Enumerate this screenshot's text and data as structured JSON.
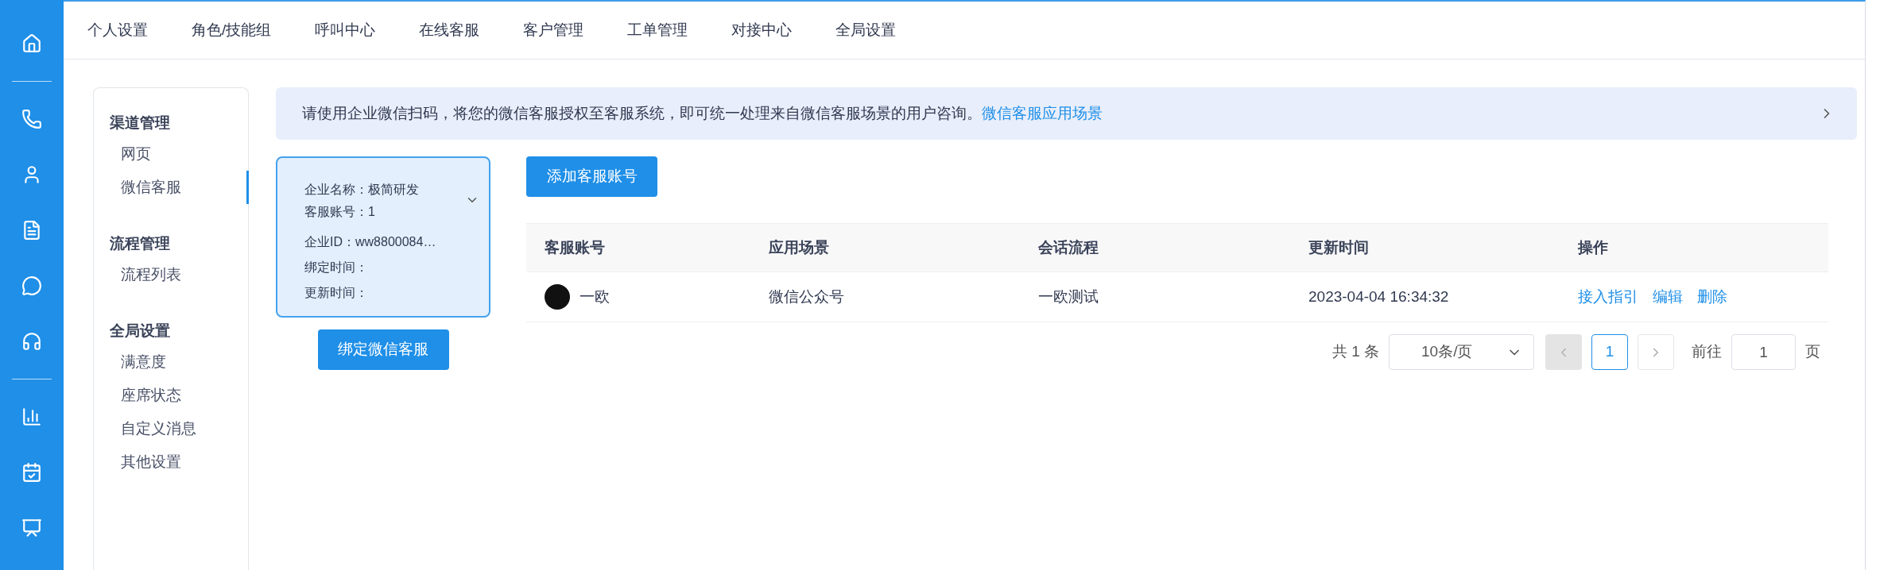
{
  "top_nav": {
    "items": [
      {
        "label": "个人设置"
      },
      {
        "label": "角色/技能组"
      },
      {
        "label": "呼叫中心"
      },
      {
        "label": "在线客服"
      },
      {
        "label": "客户管理"
      },
      {
        "label": "工单管理"
      },
      {
        "label": "对接中心"
      },
      {
        "label": "全局设置"
      }
    ]
  },
  "side_menu": {
    "groups": [
      {
        "title": "渠道管理",
        "items": [
          {
            "label": "网页",
            "selected": false
          },
          {
            "label": "微信客服",
            "selected": true
          }
        ]
      },
      {
        "title": "流程管理",
        "items": [
          {
            "label": "流程列表",
            "selected": false
          }
        ]
      },
      {
        "title": "全局设置",
        "items": [
          {
            "label": "满意度",
            "selected": false
          },
          {
            "label": "座席状态",
            "selected": false
          },
          {
            "label": "自定义消息",
            "selected": false
          },
          {
            "label": "其他设置",
            "selected": false
          }
        ]
      }
    ]
  },
  "banner": {
    "text": "请使用企业微信扫码，将您的微信客服授权至客服系统，即可统一处理来自微信客服场景的用户咨询。",
    "link": "微信客服应用场景"
  },
  "enterprise_card": {
    "selected": true,
    "lines": [
      "企业名称：极简研发",
      "客服账号：1",
      "企业ID：ww8800084…",
      "绑定时间：",
      "更新时间："
    ]
  },
  "bind_button": "绑定微信客服",
  "add_button": "添加客服账号",
  "table": {
    "columns": [
      "客服账号",
      "应用场景",
      "会话流程",
      "更新时间",
      "操作"
    ],
    "rows": [
      {
        "cells": [
          "一欧",
          "微信公众号",
          "一欧测试",
          "2023-04-04 16:34:32"
        ],
        "actions": [
          "接入指引",
          "编辑",
          "删除"
        ]
      }
    ]
  },
  "pagination": {
    "total": "共 1 条",
    "page_size": "10条/页",
    "prev": {
      "disabled": true
    },
    "pages": [
      {
        "label": "1",
        "selected": true
      }
    ],
    "next": {
      "disabled": false
    },
    "goto_label": "前往",
    "goto_value": "1",
    "goto_suffix": "页"
  }
}
